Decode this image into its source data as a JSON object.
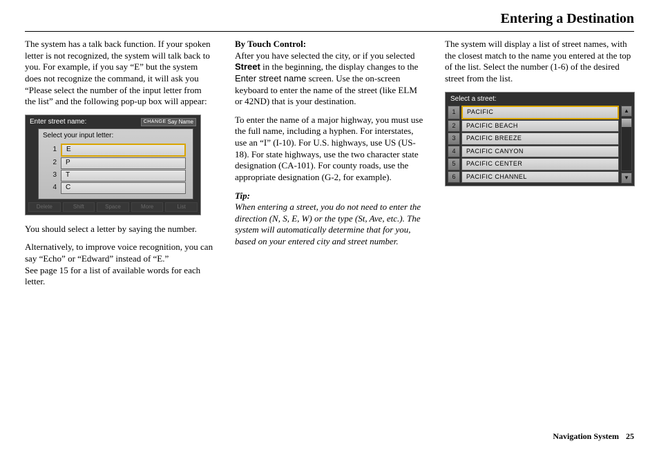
{
  "page_title": "Entering a Destination",
  "footer": {
    "label": "Navigation System",
    "page": "25"
  },
  "col1": {
    "intro": "The system has a talk back function. If your spoken letter is not recognized, the system will talk back to you. For example, if you say “E” but the system does not recognize the command, it will ask you “Please select the number of the input letter from the list” and the following pop-up box will appear:",
    "after_image": "You should select a letter by saying the number.",
    "alt_para": "Alternatively, to improve voice recognition, you can say “Echo” or “Edward” instead of “E.”\nSee page 15 for a list of available words for each letter.",
    "screen": {
      "top_label": "Enter street name:",
      "change": "CHANGE",
      "say": "Say Name",
      "popup_title": "Select your input letter:",
      "rows": [
        {
          "n": "1",
          "v": "E",
          "hl": true
        },
        {
          "n": "2",
          "v": "P",
          "hl": false
        },
        {
          "n": "3",
          "v": "T",
          "hl": false
        },
        {
          "n": "4",
          "v": "C",
          "hl": false
        }
      ],
      "btns": [
        "Delete",
        "Shift",
        "Space",
        "More",
        "List"
      ]
    }
  },
  "col2": {
    "h1": "By Touch Control:",
    "p1_a": "After you have selected the city, or if you selected ",
    "p1_b": "Street",
    "p1_c": " in the beginning, the display changes to the ",
    "p1_d": "Enter street name",
    "p1_e": " screen. Use the on-screen keyboard to enter the name of the street (like ELM or 42ND) that is your destination.",
    "p2": "To enter the name of a major highway, you must use the full name, including a hyphen. For interstates, use an “I” (I-10). For U.S. highways, use US (US-18). For state highways, use the two character state designation (CA-101). For county roads, use the appropriate designation (G-2, for example).",
    "tip_label": "Tip:",
    "tip_body": "When entering a street, you do not need to enter the direction (N, S, E, W) or the type (St, Ave, etc.). The system will automatically determine that for you, based on your entered city and street number."
  },
  "col3": {
    "p1": "The system will display a list of street names, with the closest match to the name you entered at the top of the list. Select the number (1-6) of the desired street from the list.",
    "screen": {
      "title": "Select a street:",
      "rows": [
        {
          "n": "1",
          "v": "PACIFIC",
          "hl": true
        },
        {
          "n": "2",
          "v": "PACIFIC BEACH",
          "hl": false
        },
        {
          "n": "3",
          "v": "PACIFIC BREEZE",
          "hl": false
        },
        {
          "n": "4",
          "v": "PACIFIC CANYON",
          "hl": false
        },
        {
          "n": "5",
          "v": "PACIFIC CENTER",
          "hl": false
        },
        {
          "n": "6",
          "v": "PACIFIC CHANNEL",
          "hl": false
        }
      ],
      "up": "▲",
      "down": "▼"
    }
  }
}
